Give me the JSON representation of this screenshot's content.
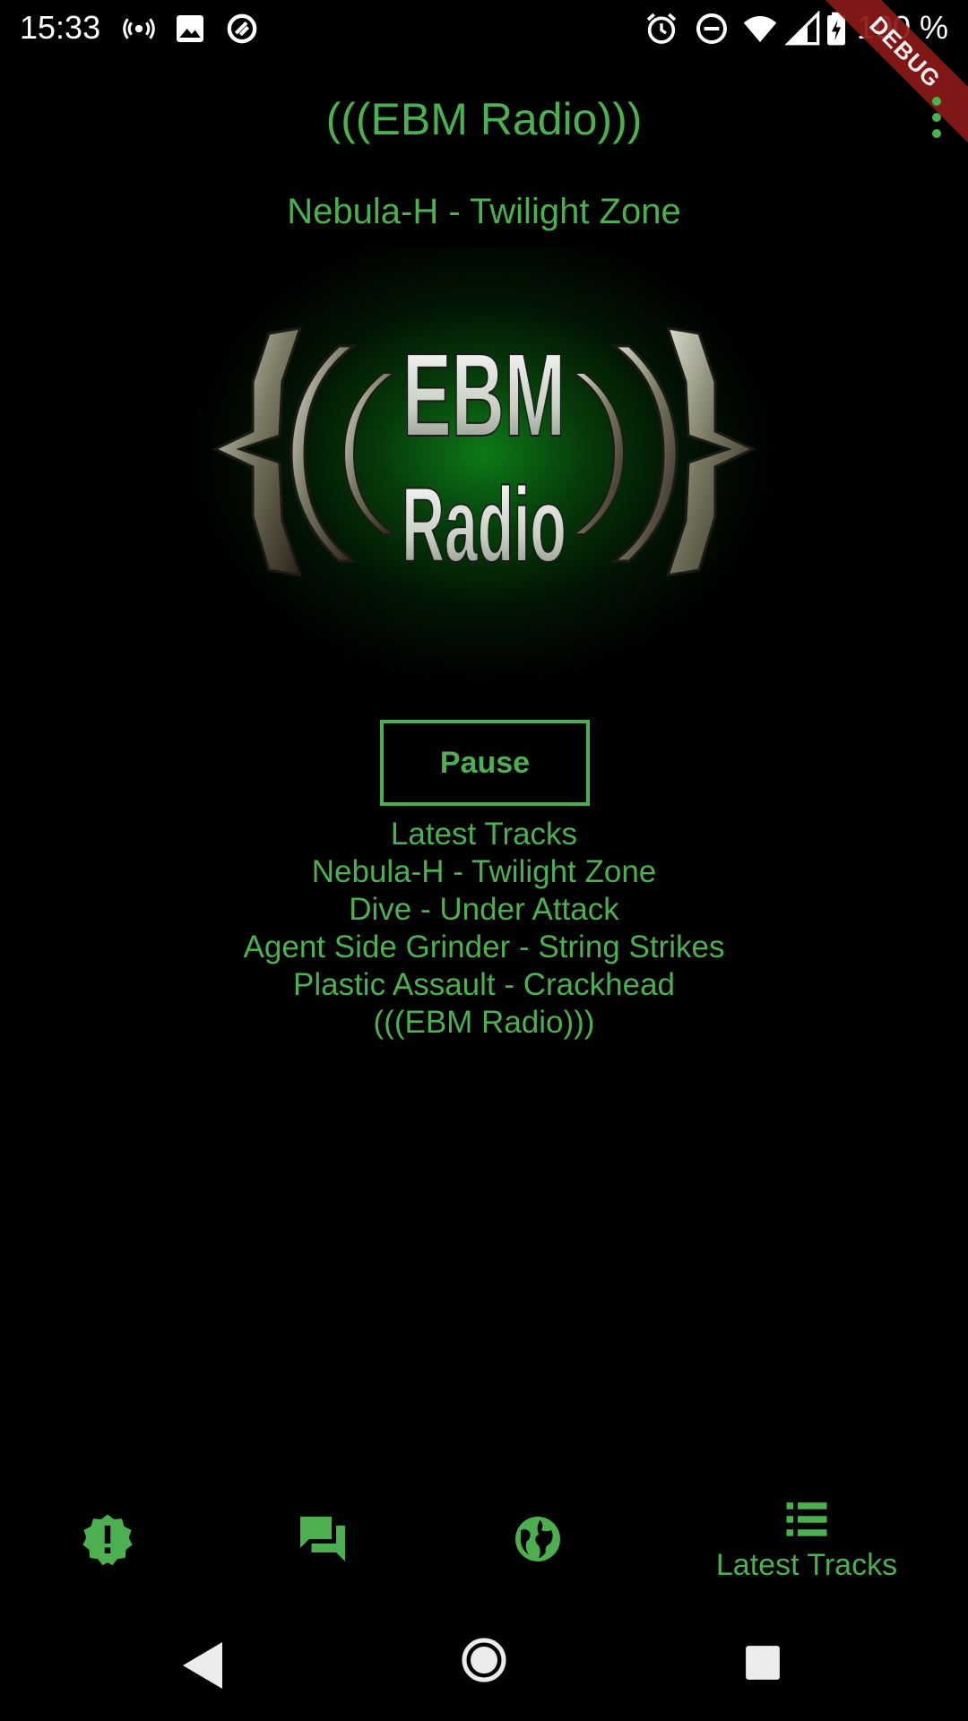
{
  "status_bar": {
    "time": "15:33",
    "battery": "100 %",
    "icons_left": [
      "radio-icon",
      "image-icon",
      "sync-icon"
    ],
    "icons_right": [
      "alarm-icon",
      "do-not-disturb-icon",
      "wifi-icon",
      "signal-icon",
      "battery-icon"
    ]
  },
  "debug_banner": "DEBUG",
  "app_bar": {
    "title": "(((EBM Radio)))",
    "menu_icon": "more-vert-icon"
  },
  "now_playing": "Nebula-H - Twilight Zone",
  "logo": {
    "top": "EBM",
    "bottom": "Radio"
  },
  "pause_label": "Pause",
  "tracks": {
    "heading": "Latest Tracks",
    "items": [
      "Nebula-H - Twilight Zone",
      "Dive - Under Attack",
      "Agent Side Grinder - String Strikes",
      "Plastic Assault - Crackhead",
      "(((EBM Radio)))"
    ]
  },
  "bottom_nav": {
    "items": [
      {
        "icon": "alert-badge-icon"
      },
      {
        "icon": "forum-icon"
      },
      {
        "icon": "globe-icon"
      },
      {
        "icon": "list-icon",
        "label": "Latest Tracks",
        "selected": true
      }
    ]
  },
  "colors": {
    "accent": "#4caf50",
    "background": "#000000",
    "debug": "#8b1a1a"
  }
}
